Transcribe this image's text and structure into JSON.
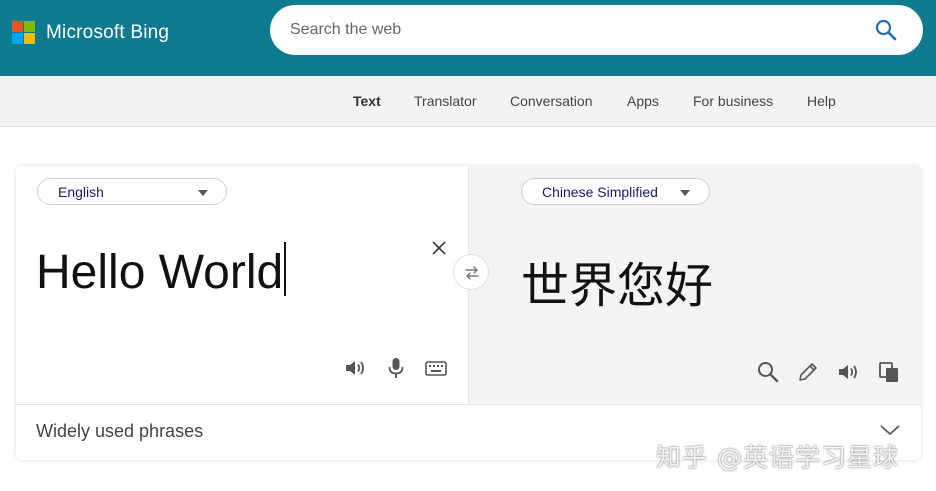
{
  "header": {
    "brand": "Microsoft Bing",
    "search_placeholder": "Search the web",
    "search_value": "",
    "bg_color": "#0d7a8f"
  },
  "nav": {
    "items": [
      {
        "label": "Text",
        "active": true
      },
      {
        "label": "Translator",
        "active": false
      },
      {
        "label": "Conversation",
        "active": false
      },
      {
        "label": "Apps",
        "active": false
      },
      {
        "label": "For business",
        "active": false
      },
      {
        "label": "Help",
        "active": false
      }
    ]
  },
  "translator": {
    "source_language": "English",
    "target_language": "Chinese Simplified",
    "source_text": "Hello World",
    "target_text": "世界您好",
    "source_icons": [
      "speaker-icon",
      "microphone-icon",
      "keyboard-icon"
    ],
    "target_icons": [
      "search-icon",
      "pencil-icon",
      "speaker-icon",
      "copy-icon"
    ],
    "phrases_label": "Widely used phrases"
  },
  "watermark": "知乎 @英语学习星球"
}
